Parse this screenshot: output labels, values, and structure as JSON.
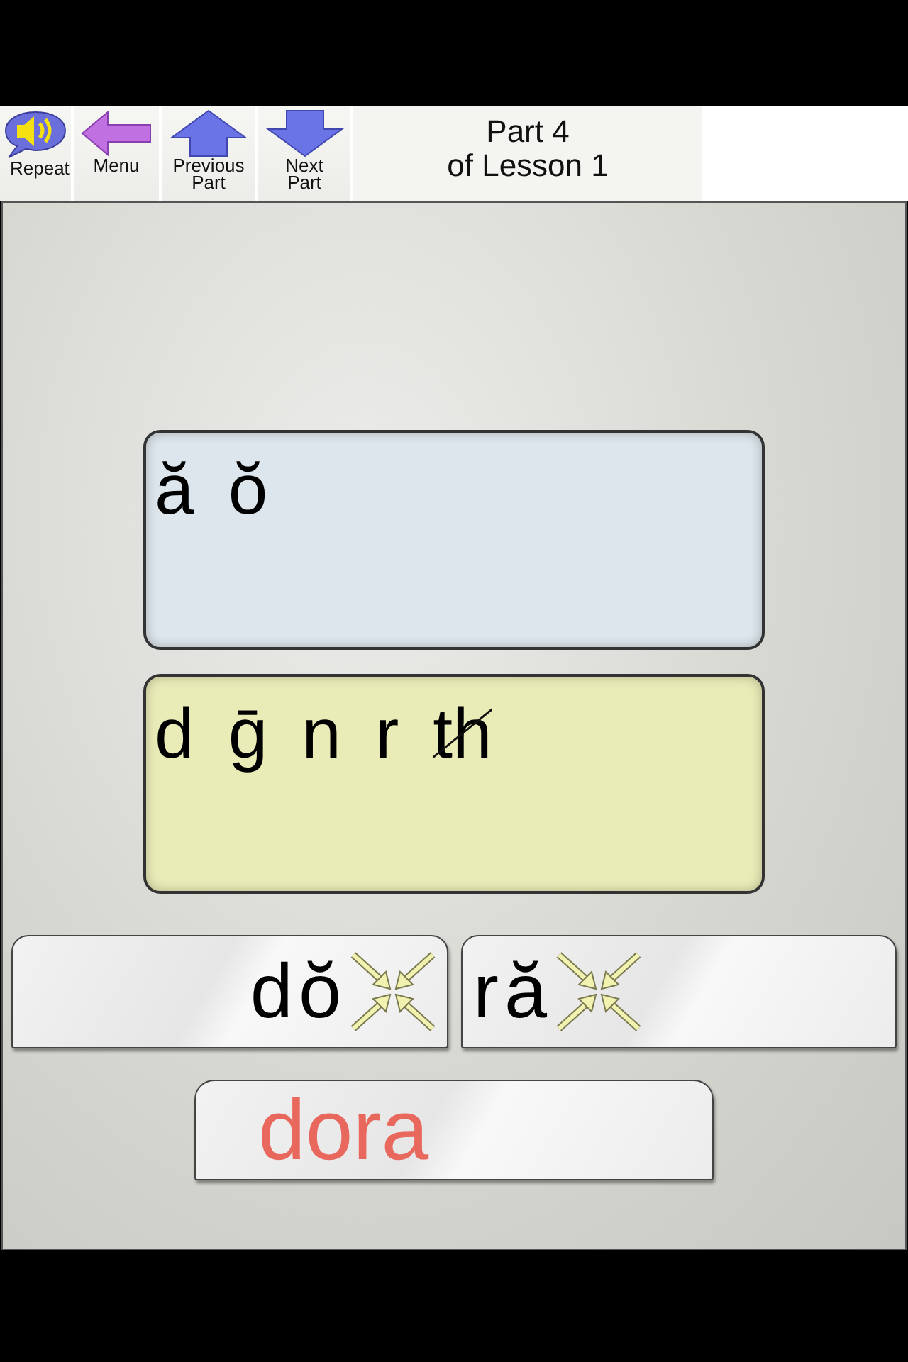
{
  "toolbar": {
    "buttons": [
      {
        "kind": "repeat",
        "label": "Repeat"
      },
      {
        "kind": "menu",
        "label": "Menu"
      },
      {
        "kind": "previous",
        "label": "Previous Part"
      },
      {
        "kind": "next",
        "label": "Next Part"
      }
    ],
    "title": [
      "Part 4",
      "of Lesson 1"
    ]
  },
  "vowels": [
    {
      "text": "ă",
      "struck": false
    },
    {
      "text": "ŏ",
      "struck": false
    }
  ],
  "consonants": [
    {
      "text": "d",
      "struck": false
    },
    {
      "text": "ḡ",
      "struck": false
    },
    {
      "text": "n",
      "struck": false
    },
    {
      "text": "r",
      "struck": false
    },
    {
      "text": "th",
      "struck": true
    }
  ],
  "syllables": [
    "dŏ",
    "ră"
  ],
  "word": {
    "text": "dora",
    "color": "#e8685e"
  }
}
